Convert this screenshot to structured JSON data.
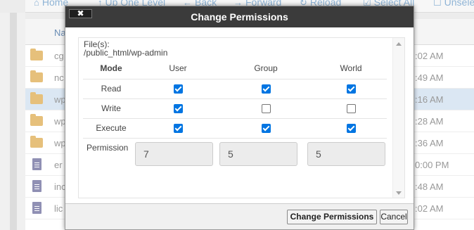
{
  "background": {
    "toolbar": [
      {
        "icon": "home-icon",
        "glyph": "⌂",
        "label": "Home"
      },
      {
        "icon": "up-arrow-icon",
        "glyph": "↑",
        "label": "Up One Level"
      },
      {
        "icon": "back-arrow-icon",
        "glyph": "←",
        "label": "Back"
      },
      {
        "icon": "forward-arrow-icon",
        "glyph": "→",
        "label": "Forward"
      },
      {
        "icon": "reload-icon",
        "glyph": "↻",
        "label": "Reload"
      },
      {
        "icon": "select-all-icon",
        "glyph": "☑",
        "label": "Select All"
      },
      {
        "icon": "unselect-icon",
        "glyph": "☐",
        "label": "Unselect"
      }
    ],
    "list_header": "Na",
    "rows": [
      {
        "icon": "folder",
        "name": "cg",
        "time": ":02 AM",
        "selected": false
      },
      {
        "icon": "folder",
        "name": "nc",
        "time": ":49 AM",
        "selected": false
      },
      {
        "icon": "folder",
        "name": "wp",
        "time": ":16 AM",
        "selected": true
      },
      {
        "icon": "folder",
        "name": "wp",
        "time": ":28 AM",
        "selected": false
      },
      {
        "icon": "folder",
        "name": "wp",
        "time": ":36 AM",
        "selected": false
      },
      {
        "icon": "file",
        "name": "er",
        "time": "0:00 PM",
        "selected": false
      },
      {
        "icon": "file",
        "name": "inc",
        "time": ":48 AM",
        "selected": false
      },
      {
        "icon": "file",
        "name": "lic",
        "time": ":02 AM",
        "selected": false
      }
    ]
  },
  "dialog": {
    "title": "Change Permissions",
    "close_label": "✖",
    "files_label": "File(s):",
    "files_path": "/public_html/wp-admin",
    "headers": {
      "mode": "Mode",
      "user": "User",
      "group": "Group",
      "world": "World"
    },
    "rows": [
      {
        "mode": "Read",
        "user": true,
        "group": true,
        "world": true
      },
      {
        "mode": "Write",
        "user": true,
        "group": false,
        "world": false
      },
      {
        "mode": "Execute",
        "user": true,
        "group": true,
        "world": true
      }
    ],
    "permission_label": "Permission",
    "octal": {
      "user": "7",
      "group": "5",
      "world": "5"
    },
    "buttons": {
      "primary": "Change Permissions",
      "cancel": "Cancel"
    }
  },
  "colors": {
    "checkbox_checked": "#0075e2",
    "titlebar": "#3b3b3b"
  }
}
